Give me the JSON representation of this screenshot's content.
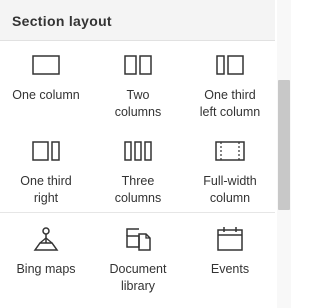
{
  "panel": {
    "title": "Section layout"
  },
  "section_layouts": [
    {
      "label_line1": "One column",
      "label_line2": "",
      "icon": "one-column-icon"
    },
    {
      "label_line1": "Two",
      "label_line2": "columns",
      "icon": "two-columns-icon"
    },
    {
      "label_line1": "One third",
      "label_line2": "left column",
      "icon": "one-third-left-icon"
    },
    {
      "label_line1": "One third",
      "label_line2": "right",
      "icon": "one-third-right-icon"
    },
    {
      "label_line1": "Three",
      "label_line2": "columns",
      "icon": "three-columns-icon"
    },
    {
      "label_line1": "Full-width",
      "label_line2": "column",
      "icon": "full-width-icon"
    }
  ],
  "web_parts": [
    {
      "label_line1": "Bing maps",
      "label_line2": "",
      "icon": "map-pin-icon"
    },
    {
      "label_line1": "Document",
      "label_line2": "library",
      "icon": "document-library-icon"
    },
    {
      "label_line1": "Events",
      "label_line2": "",
      "icon": "calendar-icon"
    }
  ],
  "colors": {
    "header_bg": "#f4f4f4",
    "text": "#333333",
    "icon_stroke": "#333333",
    "scrollbar_thumb": "#c8c8c8"
  }
}
